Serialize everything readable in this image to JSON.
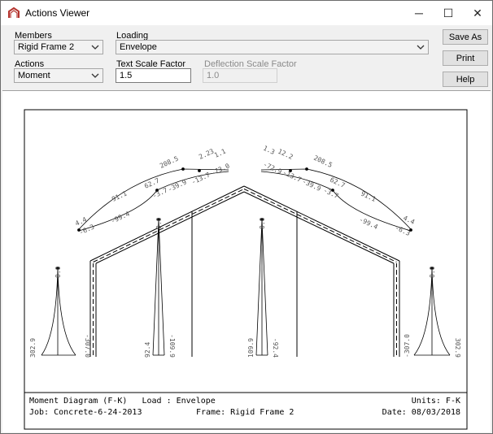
{
  "window": {
    "title": "Actions Viewer",
    "minimize_glyph": "─",
    "maximize_glyph": "☐",
    "close_glyph": "✕"
  },
  "controls": {
    "members_label": "Members",
    "members_value": "Rigid Frame 2",
    "loading_label": "Loading",
    "loading_value": "Envelope",
    "actions_label": "Actions",
    "actions_value": "Moment",
    "text_scale_label": "Text Scale Factor",
    "text_scale_value": "1.5",
    "deflection_scale_label": "Deflection Scale Factor",
    "deflection_scale_value": "1.0"
  },
  "buttons": {
    "save_as": "Save As",
    "print": "Print",
    "help": "Help"
  },
  "diagram": {
    "footer": {
      "line1_left": "Moment Diagram (F-K)   Load : Envelope",
      "line1_right": "Units: F-K",
      "line2_left": "Job: Concrete-6-24-2013",
      "line2_mid": "Frame: Rigid Frame 2",
      "line2_right": "Date: 08/03/2018"
    },
    "labels": {
      "left_rafter_top": [
        "208.5",
        "62.7",
        "91.1",
        "4.4",
        "-6.3",
        "-99.4",
        "-3.7",
        "-39.9",
        "-13.7",
        "-73.0",
        "2.23",
        "1.1"
      ],
      "right_rafter_top": [
        "1.3",
        "12.2",
        "208.5",
        "-72.9",
        "-13.7",
        "-39.9",
        "-3.7",
        "62.7",
        "91.1",
        "-99.4",
        "4.4",
        "-6.3"
      ],
      "col_a_top": "0.0",
      "col_a_left": "302.9",
      "col_a_right": "-307.0",
      "col_b_top": "0.0",
      "col_b_left": "92.4",
      "col_b_right": "-109.9",
      "col_c_top": "0.0",
      "col_c_left": "109.9",
      "col_c_right": "-92.4",
      "col_d_top": "0.0",
      "col_d_left": "-307.0",
      "col_d_right": "302.9"
    }
  },
  "colors": {
    "title_bar": "#ffffff",
    "window_bg": "#f0f0f0",
    "button_bg": "#e1e1e1",
    "icon_red": "#b5352f"
  },
  "icons": {
    "app": "frame-app-icon",
    "chevron": "chevron-down-icon"
  }
}
